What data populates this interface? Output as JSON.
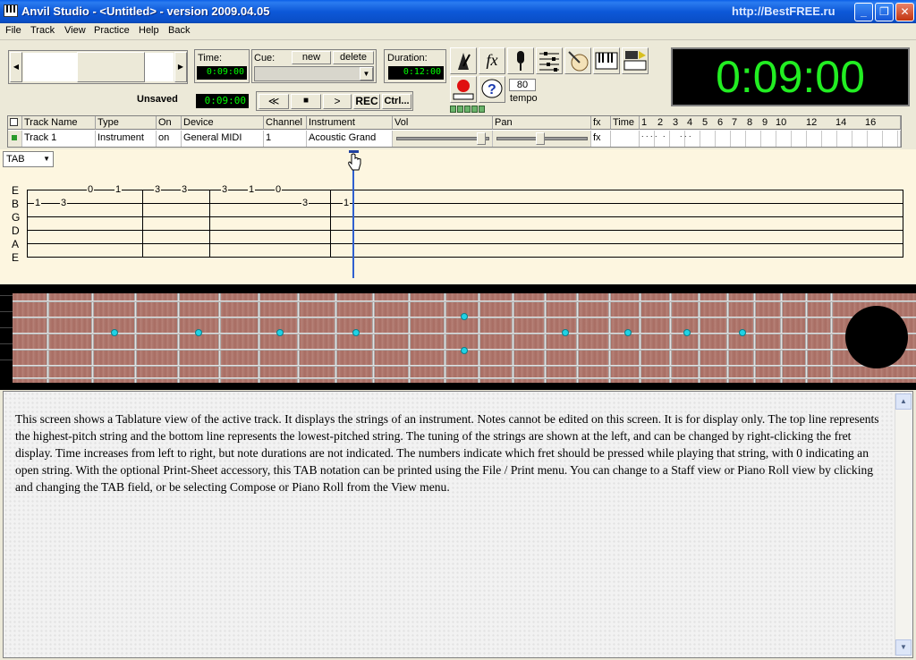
{
  "window": {
    "title": "Anvil Studio - <Untitled> - version 2009.04.05",
    "watermark": "http://BestFREE.ru",
    "minimize": "_",
    "maximize": "❐",
    "close": "✕"
  },
  "menu": [
    "File",
    "Track",
    "View",
    "Practice",
    "Help",
    "Back"
  ],
  "transport": {
    "time_label": "Time:",
    "time_value": "0:09:00",
    "cue_label": "Cue:",
    "cue_new": "new",
    "cue_delete": "delete",
    "duration_label": "Duration:",
    "duration_value": "0:12:00",
    "status": "Unsaved",
    "position_value": "0:09:00",
    "rewind": "≪",
    "stop": "■",
    "play": ">",
    "rec": "REC",
    "ctrl": "Ctrl...",
    "tempo_value": "80",
    "tempo_label": "tempo",
    "fx_label": "fx",
    "big_clock": "0:09:00"
  },
  "track_grid": {
    "headers": {
      "name": "Track Name",
      "type": "Type",
      "on": "On",
      "device": "Device",
      "channel": "Channel",
      "instrument": "Instrument",
      "vol": "Vol",
      "pan": "Pan",
      "fx": "fx",
      "time": "Time"
    },
    "measures": [
      "1",
      "2",
      "3",
      "4",
      "5",
      "6",
      "7",
      "8",
      "9",
      "10",
      "12",
      "14",
      "16"
    ],
    "row": {
      "name": "Track 1",
      "type": "Instrument",
      "on": "on",
      "device": "General MIDI",
      "channel": "1",
      "instrument": "Acoustic Grand",
      "fx": "fx",
      "time_marks": [
        ". . . .",
        ".",
        ". . ."
      ]
    }
  },
  "tab_view": {
    "view_select": "TAB",
    "strings": [
      "E",
      "B",
      "G",
      "D",
      "A",
      "E"
    ],
    "notes": [
      {
        "fret": "1",
        "string": "B"
      },
      {
        "fret": "3",
        "string": "B"
      },
      {
        "fret": "0",
        "string": "E"
      },
      {
        "fret": "1",
        "string": "E"
      },
      {
        "fret": "3",
        "string": "E"
      },
      {
        "fret": "3",
        "string": "E"
      },
      {
        "fret": "3",
        "string": "E"
      },
      {
        "fret": "1",
        "string": "E"
      },
      {
        "fret": "0",
        "string": "E"
      },
      {
        "fret": "3",
        "string": "B"
      },
      {
        "fret": "1",
        "string": "B"
      }
    ]
  },
  "description": "This screen shows a Tablature view of the active track. It displays the strings of an instrument. Notes cannot be edited on this screen. It is for display only. The top line represents the highest-pitch string and the bottom line represents the lowest-pitched string. The tuning of the strings are shown at the left, and can be changed by right-clicking the fret display. Time increases from left to right, but note durations are not indicated. The numbers indicate which fret should be pressed while playing that string, with 0 indicating an open string. With the optional Print-Sheet accessory, this TAB notation can be printed using the File / Print menu. You can change to a Staff view or Piano Roll view by clicking and changing the TAB field, or be selecting Compose or Piano Roll from the View menu."
}
